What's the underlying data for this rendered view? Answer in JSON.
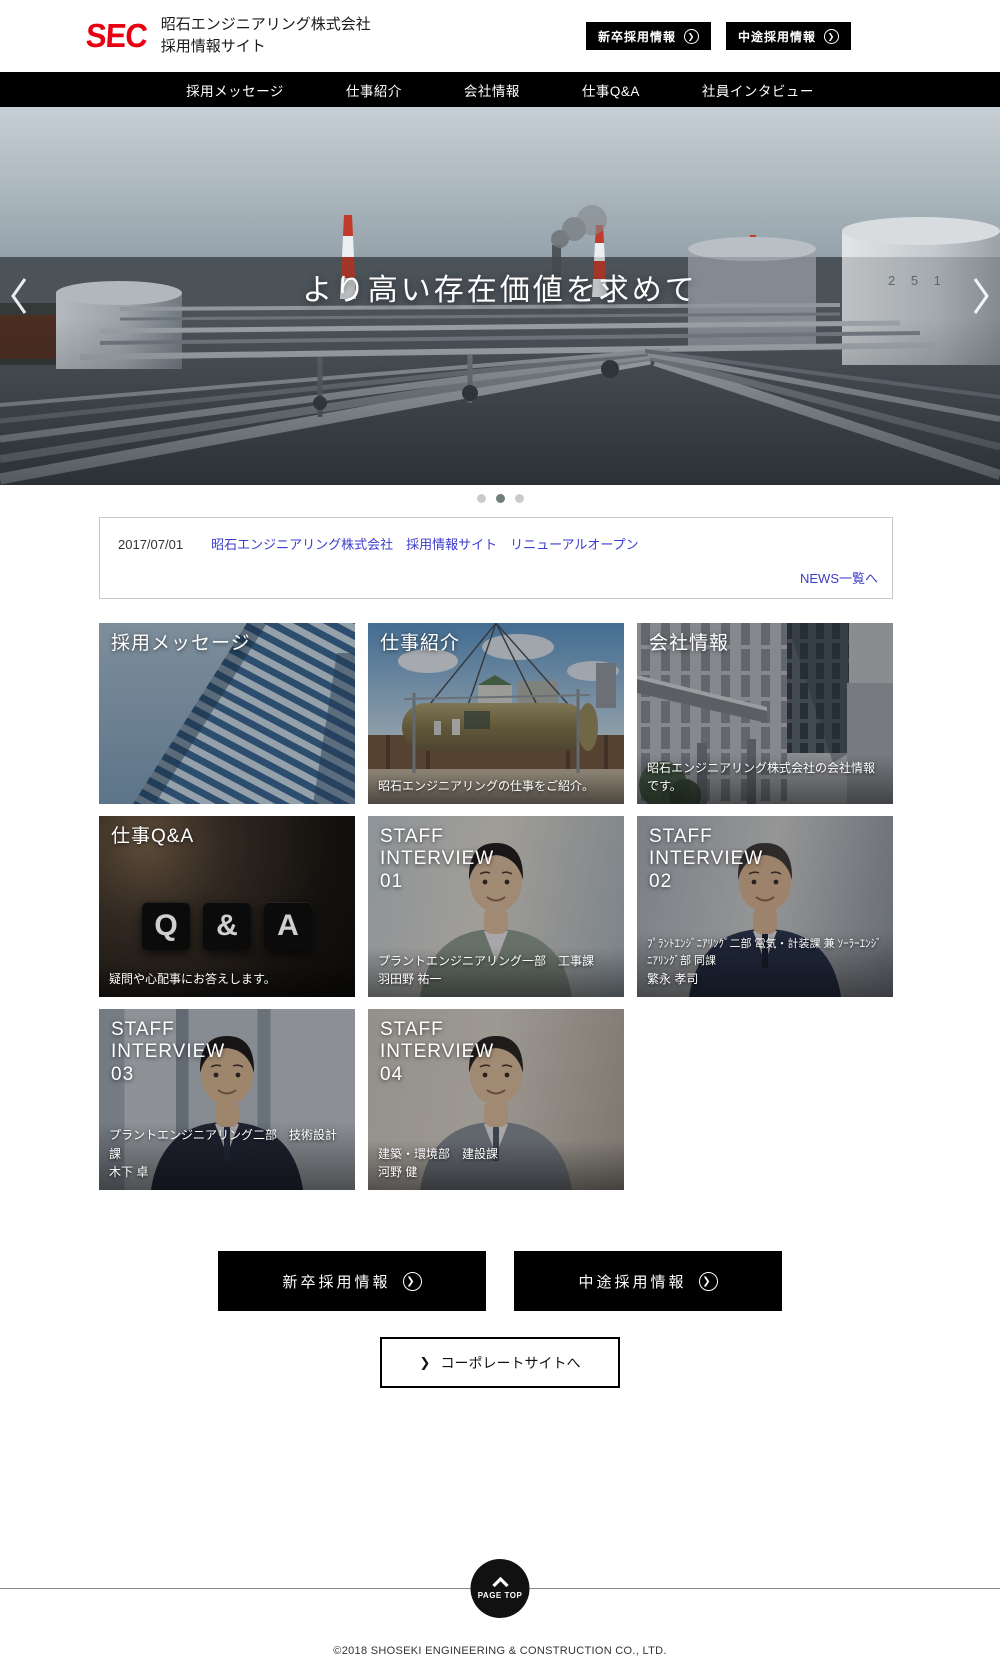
{
  "colors": {
    "accent_red": "#e60012",
    "nav_bg": "#000000",
    "link_blue": "#3c3ccc"
  },
  "header": {
    "logo": "SEC",
    "title_line1": "昭石エンジニアリング株式会社",
    "title_line2": "採用情報サイト"
  },
  "recruit": {
    "new_grad_label": "新卒採用情報",
    "mid_career_label": "中途採用情報"
  },
  "nav": {
    "items": [
      "採用メッセージ",
      "仕事紹介",
      "会社情報",
      "仕事Q&A",
      "社員インタビュー"
    ]
  },
  "hero": {
    "title": "より高い存在価値を求めて",
    "tank_label": "2 5 1",
    "dots": {
      "count": 3,
      "active_index": 1
    }
  },
  "news": {
    "date": "2017/07/01",
    "headline": "昭石エンジニアリング株式会社　採用情報サイト　リニューアルオープン",
    "more_label": "NEWS一覧へ"
  },
  "cards": [
    {
      "title": "採用メッセージ"
    },
    {
      "title": "仕事紹介",
      "caption": "昭石エンジニアリングの仕事をご紹介。"
    },
    {
      "title": "会社情報",
      "caption": "昭石エンジニアリング株式会社の会社情報です。"
    },
    {
      "title": "仕事Q&A",
      "caption": "疑問や心配事にお答えします。",
      "qa_letters": [
        "Q",
        "&",
        "A"
      ]
    },
    {
      "title_lines": [
        "STAFF",
        "INTERVIEW",
        "01"
      ],
      "caption": "プラントエンジニアリング一部　工事課",
      "name": "羽田野 祐一"
    },
    {
      "title_lines": [
        "STAFF",
        "INTERVIEW",
        "02"
      ],
      "caption": "ﾌﾟﾗﾝﾄｴﾝｼﾞﾆｱﾘﾝｸﾞ二部 電気・計装課 兼 ｿｰﾗｰｴﾝｼﾞﾆｱﾘﾝｸﾞ部 同課",
      "name": "繁永 孝司"
    },
    {
      "title_lines": [
        "STAFF",
        "INTERVIEW",
        "03"
      ],
      "caption": "プラントエンジニアリング二部　技術設計課",
      "name": "木下 卓"
    },
    {
      "title_lines": [
        "STAFF",
        "INTERVIEW",
        "04"
      ],
      "caption": "建築・環境部　建設課",
      "name": "河野 健"
    }
  ],
  "corporate_button_label": "コーポレートサイトへ",
  "pagetop_label": "PAGE TOP",
  "footer": {
    "copyright": "©2018 SHOSEKI ENGINEERING & CONSTRUCTION CO., LTD."
  }
}
